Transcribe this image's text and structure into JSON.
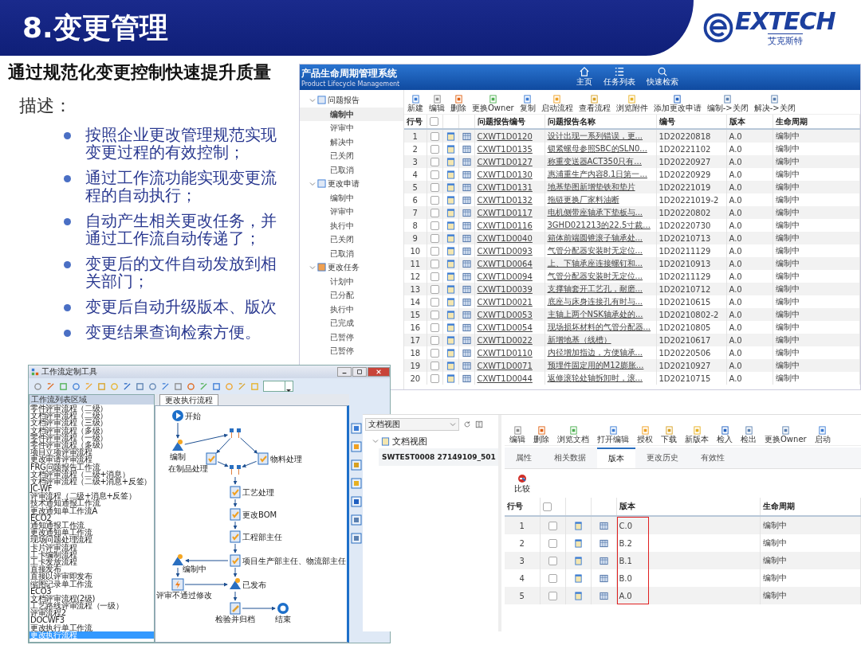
{
  "slide": {
    "title": "8.变更管理",
    "logo": {
      "brand": "EXTECH",
      "tagline": "艾克斯特"
    },
    "heading": "通过规范化变更控制快速提升质量",
    "label": "描述：",
    "bullets": [
      "按照企业更改管理规范实现变更过程的有效控制；",
      "通过工作流功能实现变更流程的自动执行；",
      "自动产生相关更改任务，并通过工作流自动传递了；",
      "变更后的文件自动发放到相关部门；",
      "变更后自动升级版本、版次",
      "变更结果查询检索方便。"
    ]
  },
  "plm_window": {
    "title": "产品生命周期管理系统",
    "subtitle": "Product Lifecycle Management",
    "nav": [
      "主页",
      "任务列表",
      "快速检索"
    ],
    "tree": [
      {
        "label": "问题报告",
        "expanded": true,
        "children": [
          {
            "label": "编制中",
            "selected": true
          },
          {
            "label": "评审中",
            "selected": false
          },
          {
            "label": "解决中",
            "selected": false
          },
          {
            "label": "已关闭",
            "selected": false
          },
          {
            "label": "已取消",
            "selected": false
          }
        ]
      },
      {
        "label": "更改申请",
        "expanded": true,
        "children": [
          {
            "label": "编制中",
            "selected": false
          },
          {
            "label": "评审中",
            "selected": false
          },
          {
            "label": "执行中",
            "selected": false
          },
          {
            "label": "已关闭",
            "selected": false
          },
          {
            "label": "已取消",
            "selected": false
          }
        ]
      },
      {
        "label": "更改任务",
        "expanded": true,
        "children": [
          {
            "label": "计划中",
            "selected": false
          },
          {
            "label": "已分配",
            "selected": false
          },
          {
            "label": "执行中",
            "selected": false
          },
          {
            "label": "已完成",
            "selected": false
          },
          {
            "label": "已暂停",
            "selected": false
          },
          {
            "label": "已暂停",
            "selected": false
          }
        ]
      }
    ],
    "toolbar": [
      "新建",
      "编辑",
      "删除",
      "更换Owner",
      "复制",
      "启动流程",
      "查看流程",
      "浏览附件",
      "添加更改申请",
      "编制->关闭",
      "解决->关闭"
    ],
    "table": {
      "columns": [
        "行号",
        "问题报告编号",
        "问题报告名称",
        "编号",
        "版本",
        "生命周期"
      ],
      "select_all": {
        "checked": false
      },
      "rows": [
        {
          "row": "1",
          "checked": false,
          "id": "CXWT1D0120",
          "name": "设计出现一系列错误，更...",
          "number": "1D20220818",
          "version": "A.0",
          "lifecycle": "编制中"
        },
        {
          "row": "2",
          "checked": false,
          "id": "CXWT1D0135",
          "name": "锁紧螺母参照SBC的SLN0...",
          "number": "1D20221102",
          "version": "A.0",
          "lifecycle": "编制中"
        },
        {
          "row": "3",
          "checked": false,
          "id": "CXWT1D0127",
          "name": "称重变送器ACT350只有...",
          "number": "1D20220927",
          "version": "A.0",
          "lifecycle": "编制中"
        },
        {
          "row": "4",
          "checked": false,
          "id": "CXWT1D0130",
          "name": "惠浦重生产内容8.1日第一...",
          "number": "1D20220929",
          "version": "A.0",
          "lifecycle": "编制中"
        },
        {
          "row": "5",
          "checked": false,
          "id": "CXWT1D0131",
          "name": "地基垫图新增垫铁和垫片",
          "number": "1D20221019",
          "version": "A.0",
          "lifecycle": "编制中"
        },
        {
          "row": "6",
          "checked": false,
          "id": "CXWT1D0132",
          "name": "拖链更换厂家料油断",
          "number": "1D20221019-2",
          "version": "A.0",
          "lifecycle": "编制中"
        },
        {
          "row": "7",
          "checked": false,
          "id": "CXWT1D0117",
          "name": "电机侧带座轴承下垫板与...",
          "number": "1D20220802",
          "version": "A.0",
          "lifecycle": "编制中"
        },
        {
          "row": "8",
          "checked": false,
          "id": "CXWT1D0116",
          "name": "3GHD021213的22.5寸裁...",
          "number": "1D20220730",
          "version": "A.0",
          "lifecycle": "编制中"
        },
        {
          "row": "9",
          "checked": false,
          "id": "CXWT1D0040",
          "name": "箱体前端圆锥滚子轴承处...",
          "number": "1D20210713",
          "version": "A.0",
          "lifecycle": "编制中"
        },
        {
          "row": "10",
          "checked": false,
          "id": "CXWT1D0093",
          "name": "气管分配器安装时无定位...",
          "number": "1D20211129",
          "version": "A.0",
          "lifecycle": "编制中"
        },
        {
          "row": "11",
          "checked": false,
          "id": "CXWT1D0064",
          "name": "上、下轴承座连接螺钉和...",
          "number": "1D20210913",
          "version": "A.0",
          "lifecycle": "编制中"
        },
        {
          "row": "12",
          "checked": false,
          "id": "CXWT1D0094",
          "name": "气管分配器安装时无定位...",
          "number": "1D20211129",
          "version": "A.0",
          "lifecycle": "编制中"
        },
        {
          "row": "13",
          "checked": false,
          "id": "CXWT1D0039",
          "name": "支撑轴套开工艺孔，耐磨...",
          "number": "1D20210712",
          "version": "A.0",
          "lifecycle": "编制中"
        },
        {
          "row": "14",
          "checked": false,
          "id": "CXWT1D0021",
          "name": "底座与床身连接孔有时与...",
          "number": "1D20210615",
          "version": "A.0",
          "lifecycle": "编制中"
        },
        {
          "row": "15",
          "checked": false,
          "id": "CXWT1D0053",
          "name": "主轴上两个NSK轴承处的...",
          "number": "1D20210802-2",
          "version": "A.0",
          "lifecycle": "编制中"
        },
        {
          "row": "16",
          "checked": false,
          "id": "CXWT1D0054",
          "name": "现场损坏材料的气管分配器...",
          "number": "1D20210805",
          "version": "A.0",
          "lifecycle": "编制中"
        },
        {
          "row": "17",
          "checked": false,
          "id": "CXWT1D0022",
          "name": "新增地基（线槽）",
          "number": "1D20210617",
          "version": "A.0",
          "lifecycle": "编制中"
        },
        {
          "row": "18",
          "checked": false,
          "id": "CXWT1D0110",
          "name": "内径增加指边，方便轴承...",
          "number": "1D20220506",
          "version": "A.0",
          "lifecycle": "编制中"
        },
        {
          "row": "19",
          "checked": false,
          "id": "CXWT1D0071",
          "name": "预埋件固定用的M12膨胀...",
          "number": "1D20210927",
          "version": "A.0",
          "lifecycle": "编制中"
        },
        {
          "row": "20",
          "checked": false,
          "id": "CXWT1D0044",
          "name": "返修滚轮处轴拆卸时，滚...",
          "number": "1D20210715",
          "version": "A.0",
          "lifecycle": "编制中"
        }
      ]
    }
  },
  "workflow_tool": {
    "title": "工作流定制工具",
    "panel_title": "工作流列表区域",
    "workflows": [
      {
        "label": "零件评审流程（二级）",
        "selected": false
      },
      {
        "label": "文档评审流程（二级）",
        "selected": false
      },
      {
        "label": "文档评审流程（三级）",
        "selected": false
      },
      {
        "label": "文档评审流程（多级）",
        "selected": false
      },
      {
        "label": "零件评审流程（一级）",
        "selected": false
      },
      {
        "label": "零件评审流程（多级）",
        "selected": false
      },
      {
        "label": "项目立项评审流程",
        "selected": false
      },
      {
        "label": "更改审请评审流程",
        "selected": false
      },
      {
        "label": "FRG问题报告工作流",
        "selected": false
      },
      {
        "label": "文档评审流程（二级+消息）",
        "selected": false
      },
      {
        "label": "文档评审流程（二级+消息+反签）",
        "selected": false
      },
      {
        "label": "JC-WF",
        "selected": false
      },
      {
        "label": "评审流程（二级+消息+反签）",
        "selected": false
      },
      {
        "label": "技术通知通报工作流",
        "selected": false
      },
      {
        "label": "更改通知单工作流A",
        "selected": false
      },
      {
        "label": "ECO2",
        "selected": false
      },
      {
        "label": "通知通报工作流",
        "selected": false
      },
      {
        "label": "更改通知单工作流",
        "selected": false
      },
      {
        "label": "现场问题处理流程",
        "selected": false
      },
      {
        "label": "卡片评审流程",
        "selected": false
      },
      {
        "label": "工卡编制流程",
        "selected": false
      },
      {
        "label": "工卡发放流程",
        "selected": false
      },
      {
        "label": "直接发布",
        "selected": false
      },
      {
        "label": "直接以评审即发布",
        "selected": false
      },
      {
        "label": "缩图记录单工作流",
        "selected": false
      },
      {
        "label": "ECO3",
        "selected": false
      },
      {
        "label": "文档评审流程(2级)",
        "selected": false
      },
      {
        "label": "工艺路线评审流程（一级）",
        "selected": false
      },
      {
        "label": "评审流程2",
        "selected": false
      },
      {
        "label": "DOCWF3",
        "selected": false
      },
      {
        "label": "更改执行单工作流",
        "selected": false
      },
      {
        "label": "更改执行流程",
        "selected": true
      }
    ],
    "tab": "更改执行流程",
    "nodes": [
      {
        "kind": "start",
        "label": "开始"
      },
      {
        "kind": "person",
        "label": "编制"
      },
      {
        "kind": "split"
      },
      {
        "kind": "task",
        "label": "在制品处理"
      },
      {
        "kind": "task",
        "label": "物料处理"
      },
      {
        "kind": "split"
      },
      {
        "kind": "task",
        "label": "工艺处理"
      },
      {
        "kind": "task",
        "label": "更改BOM"
      },
      {
        "kind": "task",
        "label": "工程部主任"
      },
      {
        "kind": "person",
        "label": "编制中"
      },
      {
        "kind": "task",
        "label": "项目生产部主任、物流部主任"
      },
      {
        "kind": "flash",
        "label": "评审不通过修改"
      },
      {
        "kind": "person",
        "label": "已发布"
      },
      {
        "kind": "edit",
        "label": "检验并归档"
      },
      {
        "kind": "end",
        "label": "结束"
      }
    ]
  },
  "document_view": {
    "view_select": "文档视图",
    "tree": {
      "label": "文档视图",
      "expanded": true,
      "children": [
        {
          "label": "SWTEST0008 27149109_501",
          "selected": true
        }
      ]
    },
    "toolbar": [
      "编辑",
      "删除",
      "浏览文档",
      "打开编辑",
      "授权",
      "下载",
      "新版本",
      "检入",
      "检出",
      "更换Owner",
      "启动"
    ],
    "tabs": [
      {
        "label": "属性",
        "selected": false
      },
      {
        "label": "相关数据",
        "selected": false
      },
      {
        "label": "版本",
        "selected": true
      },
      {
        "label": "更改历史",
        "selected": false
      },
      {
        "label": "有效性",
        "selected": false
      }
    ],
    "compare_button": "比较",
    "table": {
      "columns": [
        "行号",
        "版本",
        "生命周期"
      ],
      "select_all": {
        "checked": false
      },
      "rows": [
        {
          "row": "1",
          "checked": false,
          "version": "C.0",
          "lifecycle": "编制中"
        },
        {
          "row": "2",
          "checked": false,
          "version": "B.2",
          "lifecycle": "编制中"
        },
        {
          "row": "3",
          "checked": false,
          "version": "B.1",
          "lifecycle": "编制中"
        },
        {
          "row": "4",
          "checked": false,
          "version": "B.0",
          "lifecycle": "编制中"
        },
        {
          "row": "5",
          "checked": false,
          "version": "A.0",
          "lifecycle": "编制中"
        }
      ]
    }
  }
}
